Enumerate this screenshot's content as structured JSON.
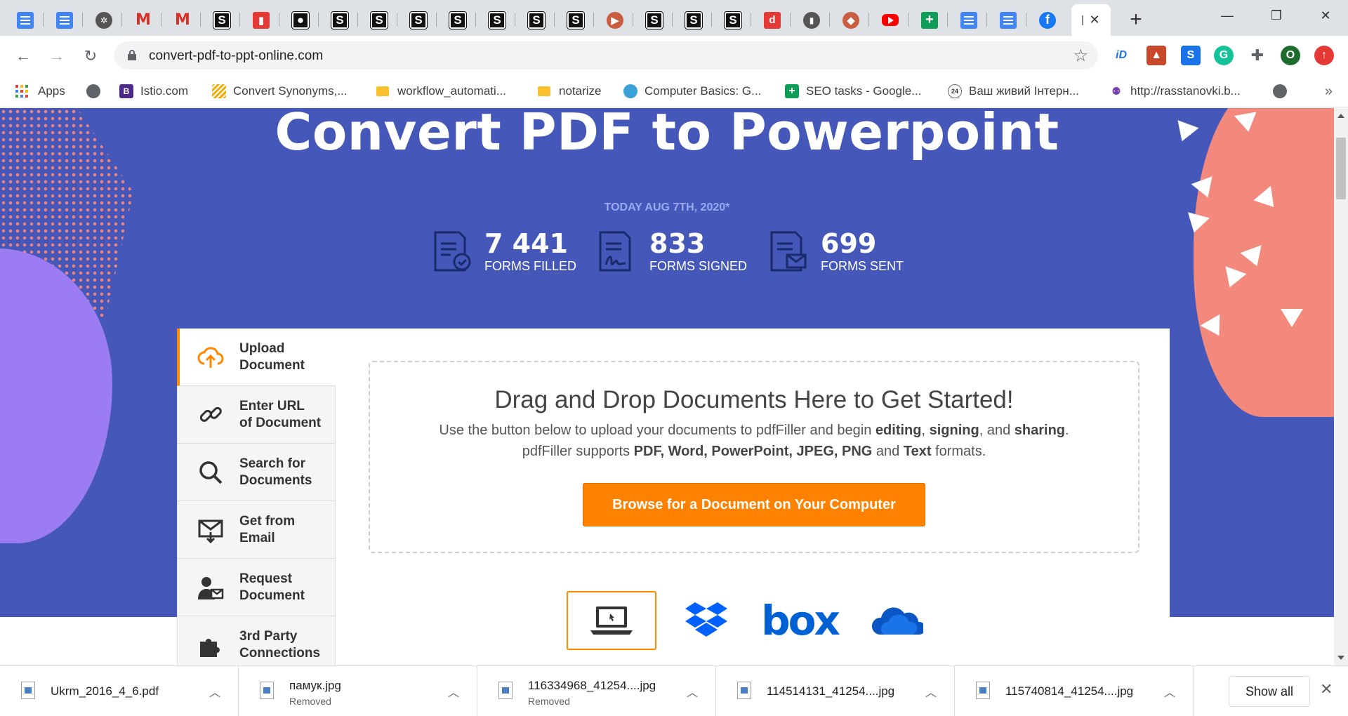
{
  "browser": {
    "tabs": [
      {
        "icon": "docs-icon"
      },
      {
        "icon": "docs-icon"
      },
      {
        "icon": "extension-icon"
      },
      {
        "icon": "gmail-icon"
      },
      {
        "icon": "gmail-icon"
      },
      {
        "icon": "s-icon"
      },
      {
        "icon": "pdf-icon"
      },
      {
        "icon": "record-icon"
      },
      {
        "icon": "s-icon"
      },
      {
        "icon": "s-icon"
      },
      {
        "icon": "s-icon"
      },
      {
        "icon": "s-icon"
      },
      {
        "icon": "s-icon"
      },
      {
        "icon": "s-icon"
      },
      {
        "icon": "s-icon"
      },
      {
        "icon": "truck-icon"
      },
      {
        "icon": "s-icon"
      },
      {
        "icon": "s-icon"
      },
      {
        "icon": "s-icon"
      },
      {
        "icon": "d-icon"
      },
      {
        "icon": "pdf-icon"
      },
      {
        "icon": "map-icon"
      },
      {
        "icon": "youtube-icon"
      },
      {
        "icon": "sheets-icon"
      },
      {
        "icon": "docs-icon"
      },
      {
        "icon": "docs-icon"
      },
      {
        "icon": "facebook-icon"
      }
    ],
    "active_tab_icon": "pdffiller-icon",
    "url": "convert-pdf-to-ppt-online.com",
    "profile_initial": "O",
    "bookmarks": [
      {
        "label": "Apps",
        "icon": "apps-grid-icon"
      },
      {
        "label": "",
        "icon": "globe-icon"
      },
      {
        "label": "Istio.com",
        "icon": "b-icon"
      },
      {
        "label": "Convert Synonyms,...",
        "icon": "stripes-icon"
      },
      {
        "label": "workflow_automati...",
        "icon": "folder-icon"
      },
      {
        "label": "notarize",
        "icon": "folder-icon"
      },
      {
        "label": "Computer Basics: G...",
        "icon": "gcf-icon"
      },
      {
        "label": "SEO tasks - Google...",
        "icon": "sheets-icon"
      },
      {
        "label": "Ваш живий Інтерн...",
        "icon": "24-icon"
      },
      {
        "label": "http://rasstanovki.b...",
        "icon": "people-icon"
      },
      {
        "label": "",
        "icon": "globe-icon"
      }
    ]
  },
  "hero": {
    "title": "Convert PDF to Powerpoint",
    "date_text": "TODAY AUG 7TH, 2020*",
    "stats": [
      {
        "value": "7 441",
        "label": "FORMS FILLED",
        "icon": "form-filled-icon"
      },
      {
        "value": "833",
        "label": "FORMS SIGNED",
        "icon": "form-signed-icon"
      },
      {
        "value": "699",
        "label": "FORMS SENT",
        "icon": "form-sent-icon"
      }
    ]
  },
  "sidenav": [
    {
      "label": "Upload\nDocument",
      "icon": "cloud-upload-icon",
      "active": true
    },
    {
      "label": "Enter URL\nof Document",
      "icon": "link-icon",
      "active": false
    },
    {
      "label": "Search for\nDocuments",
      "icon": "search-icon",
      "active": false
    },
    {
      "label": "Get from\nEmail",
      "icon": "email-icon",
      "active": false
    },
    {
      "label": "Request\nDocument",
      "icon": "request-user-icon",
      "active": false
    },
    {
      "label": "3rd Party\nConnections",
      "icon": "puzzle-icon",
      "active": false
    }
  ],
  "dropzone": {
    "title": "Drag and Drop Documents Here to Get Started!",
    "line1_a": "Use the button below to upload your documents to pdfFiller and begin ",
    "line1_b1": "editing",
    "line1_c1": ", ",
    "line1_b2": "signing",
    "line1_c2": ", and ",
    "line1_b3": "sharing",
    "line1_c3": ".",
    "line2_a": "pdfFiller supports ",
    "line2_b": "PDF, Word, PowerPoint, JPEG, PNG",
    "line2_c": " and ",
    "line2_d": "Text",
    "line2_e": " formats.",
    "button": "Browse for a Document on Your Computer"
  },
  "sources": [
    {
      "icon": "laptop-icon",
      "selected": true
    },
    {
      "icon": "dropbox-icon",
      "selected": false
    },
    {
      "icon": "box-icon",
      "label": "box",
      "selected": false
    },
    {
      "icon": "onedrive-icon",
      "selected": false
    }
  ],
  "downloads": [
    {
      "name": "Ukrm_2016_4_6.pdf",
      "status": ""
    },
    {
      "name": "памук.jpg",
      "status": "Removed"
    },
    {
      "name": "116334968_41254....jpg",
      "status": "Removed"
    },
    {
      "name": "114514131_41254....jpg",
      "status": ""
    },
    {
      "name": "115740814_41254....jpg",
      "status": ""
    }
  ],
  "show_all": "Show all",
  "colors": {
    "hero_bg": "#4558b9",
    "accent": "#ff8100",
    "blob_pink": "#f3897d",
    "blob_purple": "#9c7cf3"
  }
}
